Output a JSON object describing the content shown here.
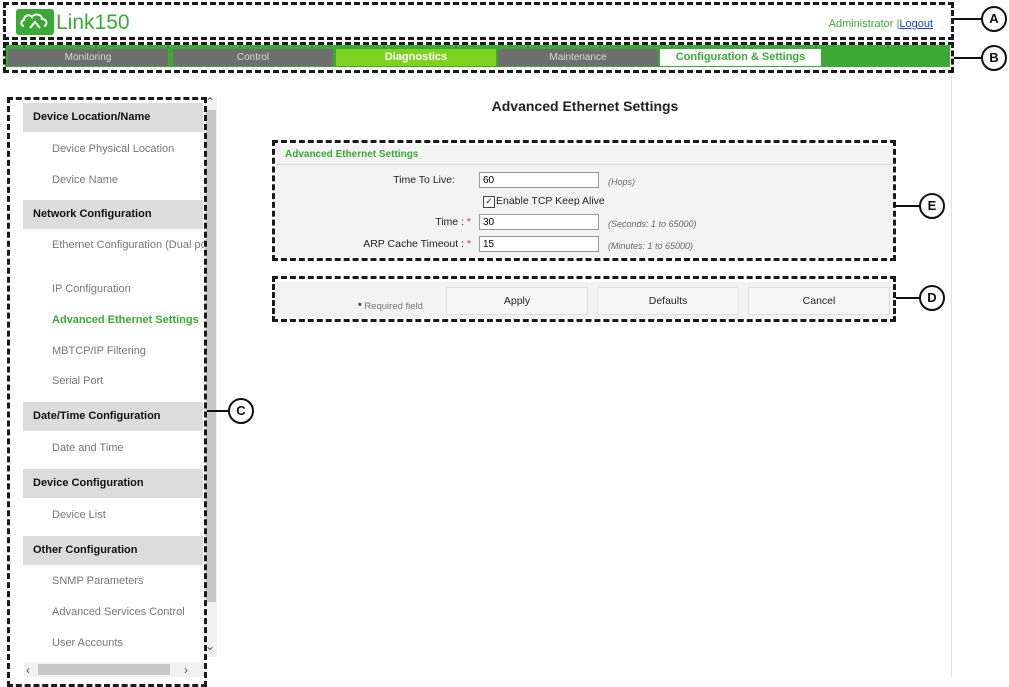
{
  "header": {
    "app_name": "Link150",
    "user": "Administrator",
    "separator": "|",
    "logout": "Logout"
  },
  "nav": {
    "tabs": [
      {
        "label": "Monitoring"
      },
      {
        "label": "Control"
      },
      {
        "label": "Diagnostics",
        "state": "active"
      },
      {
        "label": "Maintenance"
      },
      {
        "label": "Configuration & Settings",
        "state": "selected"
      }
    ]
  },
  "sidebar": {
    "sections": [
      {
        "title": "Device Location/Name",
        "items": [
          "Device Physical Location",
          "Device Name"
        ]
      },
      {
        "title": "Network Configuration",
        "items": [
          "Ethernet Configuration (Dual port)",
          "IP Configuration",
          "Advanced Ethernet Settings",
          "MBTCP/IP Filtering",
          "Serial Port"
        ]
      },
      {
        "title": "Date/Time Configuration",
        "items": [
          "Date and Time"
        ]
      },
      {
        "title": "Device Configuration",
        "items": [
          "Device List"
        ]
      },
      {
        "title": "Other Configuration",
        "items": [
          "SNMP Parameters",
          "Advanced Services Control",
          "User Accounts"
        ]
      }
    ],
    "selected_item": "Advanced Ethernet Settings"
  },
  "main": {
    "title": "Advanced Ethernet Settings",
    "panel": {
      "heading": "Advanced Ethernet Settings",
      "fields": {
        "ttl": {
          "label": "Time To Live:",
          "value": "60",
          "hint": "(Hops)"
        },
        "keepalive": {
          "label": "Enable TCP Keep Alive",
          "checked": true,
          "mark": "✓"
        },
        "time": {
          "label": "Time :",
          "required": "*",
          "value": "30",
          "hint": "(Seconds: 1 to 65000)"
        },
        "arp": {
          "label": "ARP Cache Timeout :",
          "required": "*",
          "value": "15",
          "hint": "(Minutes: 1 to 65000)"
        }
      }
    },
    "actions": {
      "required_mark": "*",
      "required_note": "Required field",
      "apply": "Apply",
      "defaults": "Defaults",
      "cancel": "Cancel"
    }
  },
  "callouts": {
    "a": "A",
    "b": "B",
    "c": "C",
    "d": "D",
    "e": "E"
  },
  "colors": {
    "brand_green": "#3aaa35",
    "active_tab": "#7ed321",
    "tab_grey": "#6e6e6e",
    "link_blue": "#1a3fd8",
    "required_red": "#d33333"
  }
}
